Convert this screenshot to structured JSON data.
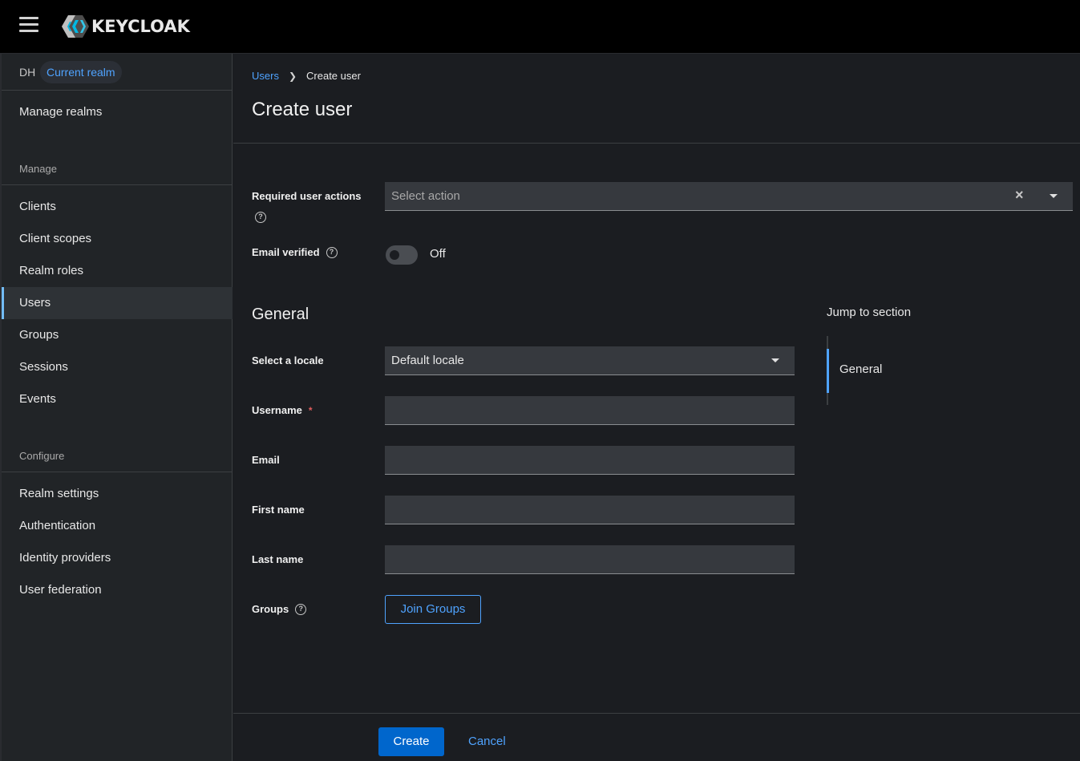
{
  "header": {
    "brand": "KEYCLOAK",
    "menu_icon": "hamburger-icon",
    "logo_icon": "keycloak-logo-icon"
  },
  "sidebar": {
    "realm_short": "DH",
    "realm_badge": "Current realm",
    "manage_realms": "Manage realms",
    "manage_section": "Manage",
    "manage_items": [
      "Clients",
      "Client scopes",
      "Realm roles",
      "Users",
      "Groups",
      "Sessions",
      "Events"
    ],
    "active_item": "Users",
    "configure_section": "Configure",
    "configure_items": [
      "Realm settings",
      "Authentication",
      "Identity providers",
      "User federation"
    ]
  },
  "breadcrumb": {
    "parent": "Users",
    "current": "Create user"
  },
  "page": {
    "title": "Create user"
  },
  "form": {
    "required_actions_label": "Required user actions",
    "required_actions_placeholder": "Select action",
    "email_verified_label": "Email verified",
    "email_verified_state": "Off",
    "general_title": "General",
    "locale_label": "Select a locale",
    "locale_value": "Default locale",
    "username_label": "Username",
    "username_required": "*",
    "username_value": "",
    "email_label": "Email",
    "email_value": "",
    "first_name_label": "First name",
    "first_name_value": "",
    "last_name_label": "Last name",
    "last_name_value": "",
    "groups_label": "Groups",
    "join_groups_button": "Join Groups"
  },
  "jump": {
    "title": "Jump to section",
    "items": [
      "General"
    ]
  },
  "footer": {
    "create_button": "Create",
    "cancel_button": "Cancel"
  },
  "colors": {
    "accent": "#4fa3ff",
    "primary_button": "#0066cc",
    "required": "#e05c5c"
  }
}
